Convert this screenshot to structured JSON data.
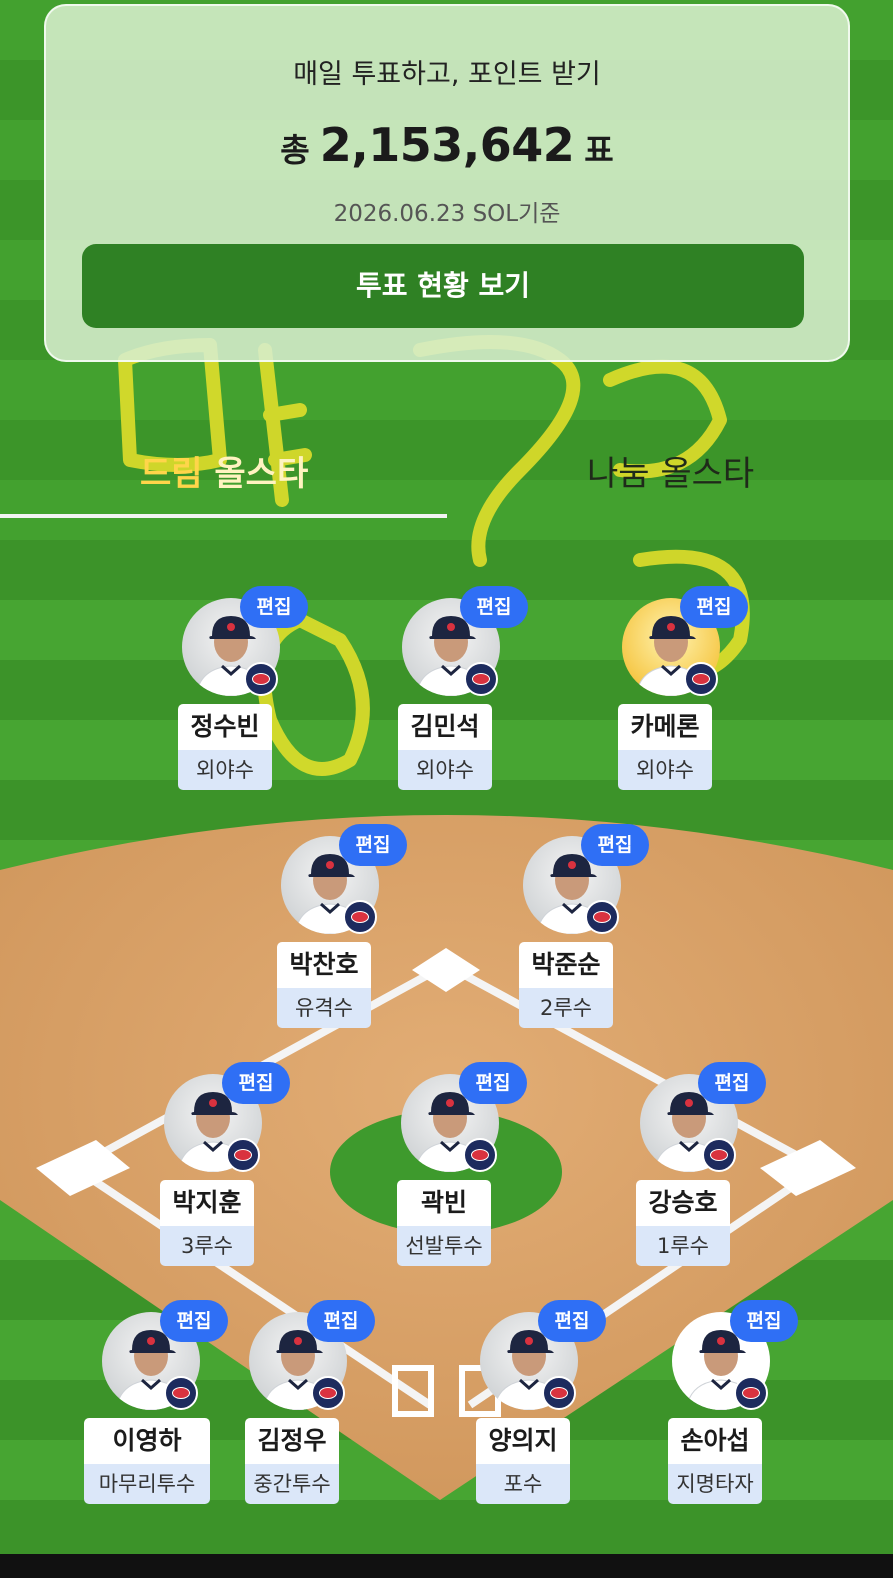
{
  "vote": {
    "subtitle": "매일 투표하고, 포인트 받기",
    "total_prefix": "총",
    "total_value": "2,153,642",
    "total_suffix": "표",
    "date": "2026.06.23 SOL기준",
    "status_button": "투표 현황 보기"
  },
  "tabs": {
    "dream_highlight": "드림",
    "dream_rest": " 올스타",
    "nanum": "나눔 올스타"
  },
  "edit_label": "편집",
  "players": [
    {
      "name": "정수빈",
      "position": "외야수"
    },
    {
      "name": "김민석",
      "position": "외야수"
    },
    {
      "name": "카메론",
      "position": "외야수"
    },
    {
      "name": "박찬호",
      "position": "유격수"
    },
    {
      "name": "박준순",
      "position": "2루수"
    },
    {
      "name": "박지훈",
      "position": "3루수"
    },
    {
      "name": "곽빈",
      "position": "선발투수"
    },
    {
      "name": "강승호",
      "position": "1루수"
    },
    {
      "name": "이영하",
      "position": "마무리투수"
    },
    {
      "name": "김정우",
      "position": "중간투수"
    },
    {
      "name": "양의지",
      "position": "포수"
    },
    {
      "name": "손아섭",
      "position": "지명타자"
    }
  ],
  "colors": {
    "grass": "#3f9a2c",
    "dirt": "#d9a36a",
    "accent_button": "#2f8124",
    "edit_badge": "#2f6ff5",
    "tab_active": "#ffd54a"
  }
}
